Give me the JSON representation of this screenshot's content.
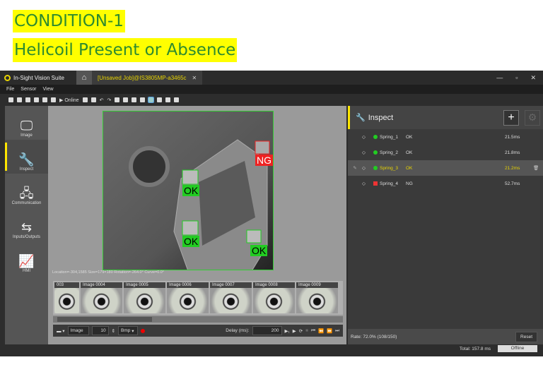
{
  "slide": {
    "heading1": "CONDITION-1",
    "heading2": "Helicoil Present or Absence"
  },
  "titlebar": {
    "app_name": "In-Sight Vision Suite",
    "tab_title": "[Unsaved Job]@IS3805MP-a3465c",
    "close": "✕",
    "minimize": "—",
    "restore": "▫",
    "close_window": "✕"
  },
  "menu": [
    "File",
    "Sensor",
    "View"
  ],
  "toolbar": {
    "online_label": "Online"
  },
  "nav": [
    {
      "label": "Image",
      "icon": "🖵"
    },
    {
      "label": "Inspect",
      "icon": "🔧"
    },
    {
      "label": "Communication",
      "icon": "🖧"
    },
    {
      "label": "Inputs/Outputs",
      "icon": "⇆"
    },
    {
      "label": "HMI",
      "icon": "📈"
    }
  ],
  "image_view": {
    "labels": [
      "NG",
      "OK",
      "OK",
      "OK"
    ],
    "location_text": "Location=-304,1585 Size=179×180 Rotation=-264.0° Curve=0.0°"
  },
  "filmstrip": [
    "003",
    "Image 0004",
    "Image 0005",
    "Image 0006",
    "Image 0007",
    "Image 0008",
    "Image 0009"
  ],
  "controls": {
    "image_label": "Image",
    "count": "10",
    "format": "Bmp",
    "delay_label": "Delay (ms):",
    "delay": "200"
  },
  "inspect": {
    "title": "Inspect",
    "add": "+",
    "gear": "⚙",
    "rows": [
      {
        "name": "Spring_1",
        "result": "OK",
        "time": "21.5ms",
        "status": "pass"
      },
      {
        "name": "Spring_2",
        "result": "OK",
        "time": "21.8ms",
        "status": "pass"
      },
      {
        "name": "Spring_3",
        "result": "OK",
        "time": "21.2ms",
        "status": "pass"
      },
      {
        "name": "Spring_4",
        "result": "NG",
        "time": "52.7ms",
        "status": "fail"
      }
    ],
    "rate": "Rate: 72.0% (108/150)",
    "reset": "Reset"
  },
  "status": {
    "total": "Total: 157.8 ms",
    "mode": "Offline"
  },
  "colors": {
    "accent": "#ffe600",
    "ok": "#22cc22",
    "ng": "#ee2222"
  }
}
